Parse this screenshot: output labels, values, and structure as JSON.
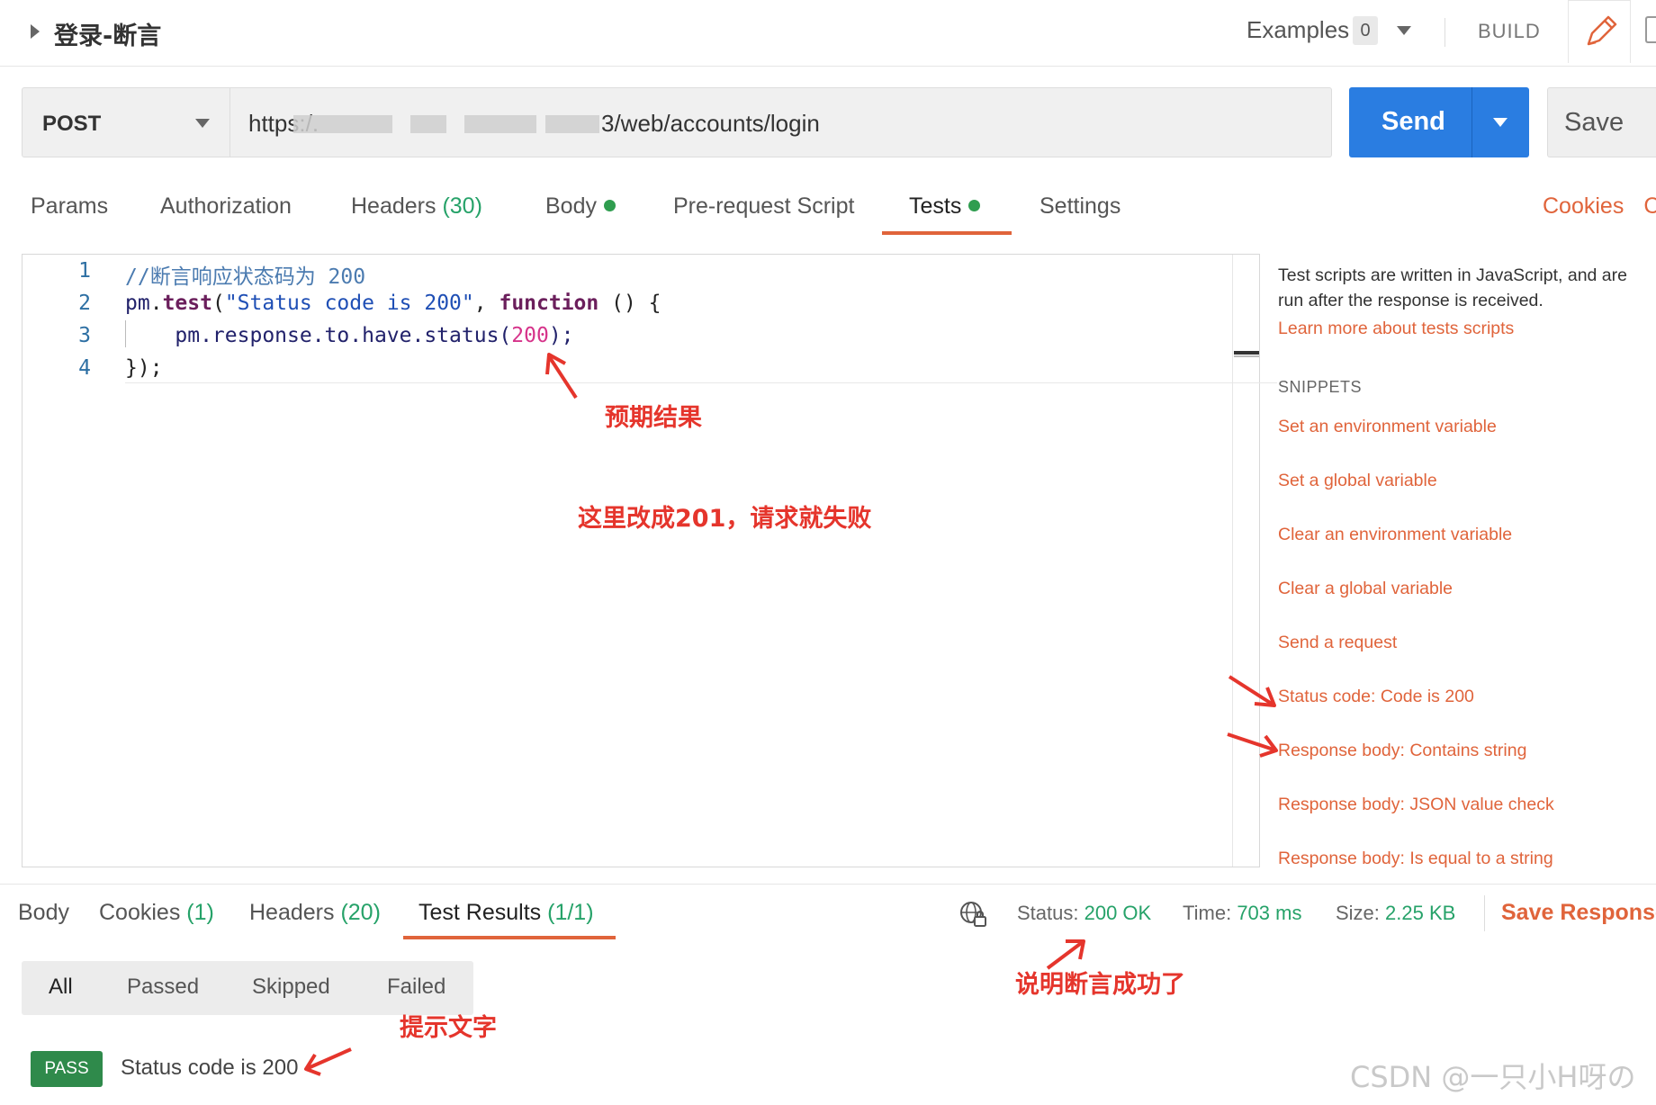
{
  "header": {
    "title": "登录-断言",
    "examples_label": "Examples",
    "examples_count": "0",
    "build_label": "BUILD"
  },
  "request": {
    "method": "POST",
    "url_start": "https:/.",
    "url_end": "3/web/accounts/login",
    "send_label": "Send",
    "save_label": "Save"
  },
  "req_tabs": {
    "params": "Params",
    "authorization": "Authorization",
    "headers": "Headers",
    "headers_count": "(30)",
    "body": "Body",
    "prerequest": "Pre-request Script",
    "tests": "Tests",
    "settings": "Settings",
    "cookies": "Cookies",
    "code_partial": "C"
  },
  "editor": {
    "line_numbers": [
      "1",
      "2",
      "3",
      "4"
    ],
    "l1": "//断言响应状态码为 200",
    "l2_obj": "pm",
    "l2_dot": ".",
    "l2_fn": "test",
    "l2_open": "(",
    "l2_str": "\"Status code is 200\"",
    "l2_comma": ", ",
    "l2_kw": "function",
    "l2_rest": " () {",
    "l3_pre": "    pm.response.to.have.status(",
    "l3_num": "200",
    "l3_post": ");",
    "l4": "});"
  },
  "snippets": {
    "description": "Test scripts are written in JavaScript, and are run after the response is received.",
    "learn_more": "Learn more about tests scripts",
    "heading": "SNIPPETS",
    "items": [
      "Set an environment variable",
      "Set a global variable",
      "Clear an environment variable",
      "Clear a global variable",
      "Send a request",
      "Status code: Code is 200",
      "Response body: Contains string",
      "Response body: JSON value check",
      "Response body: Is equal to a string"
    ]
  },
  "response": {
    "tabs": {
      "body": "Body",
      "cookies": "Cookies",
      "cookies_count": "(1)",
      "headers": "Headers",
      "headers_count": "(20)",
      "test_results": "Test Results",
      "test_results_count": "(1/1)"
    },
    "status_label": "Status:",
    "status_value": "200 OK",
    "time_label": "Time:",
    "time_value": "703 ms",
    "size_label": "Size:",
    "size_value": "2.25 KB",
    "save_response": "Save Response"
  },
  "filters": {
    "all": "All",
    "passed": "Passed",
    "skipped": "Skipped",
    "failed": "Failed"
  },
  "result": {
    "badge": "PASS",
    "name": "Status code is 200"
  },
  "annotations": {
    "expected": "预期结果",
    "change_note": "这里改成201，请求就失败",
    "assert_ok": "说明断言成功了",
    "hint_text": "提示文字"
  },
  "watermark": "CSDN @一只小H呀の",
  "colors": {
    "accent": "#e0643b",
    "send_blue": "#2a7de1",
    "success_green": "#26a269",
    "annotation_red": "#e5352c"
  }
}
